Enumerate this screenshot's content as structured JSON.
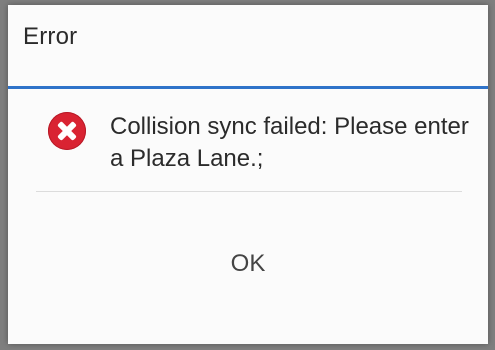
{
  "dialog": {
    "title": "Error",
    "message": "Collision sync failed: Please enter a Plaza Lane.;",
    "icon": "error-icon",
    "ok_label": "OK"
  },
  "colors": {
    "accent": "#2f73c9",
    "error": "#d92332",
    "background": "#fbfbfb",
    "overlay": "#7f7f7f"
  }
}
